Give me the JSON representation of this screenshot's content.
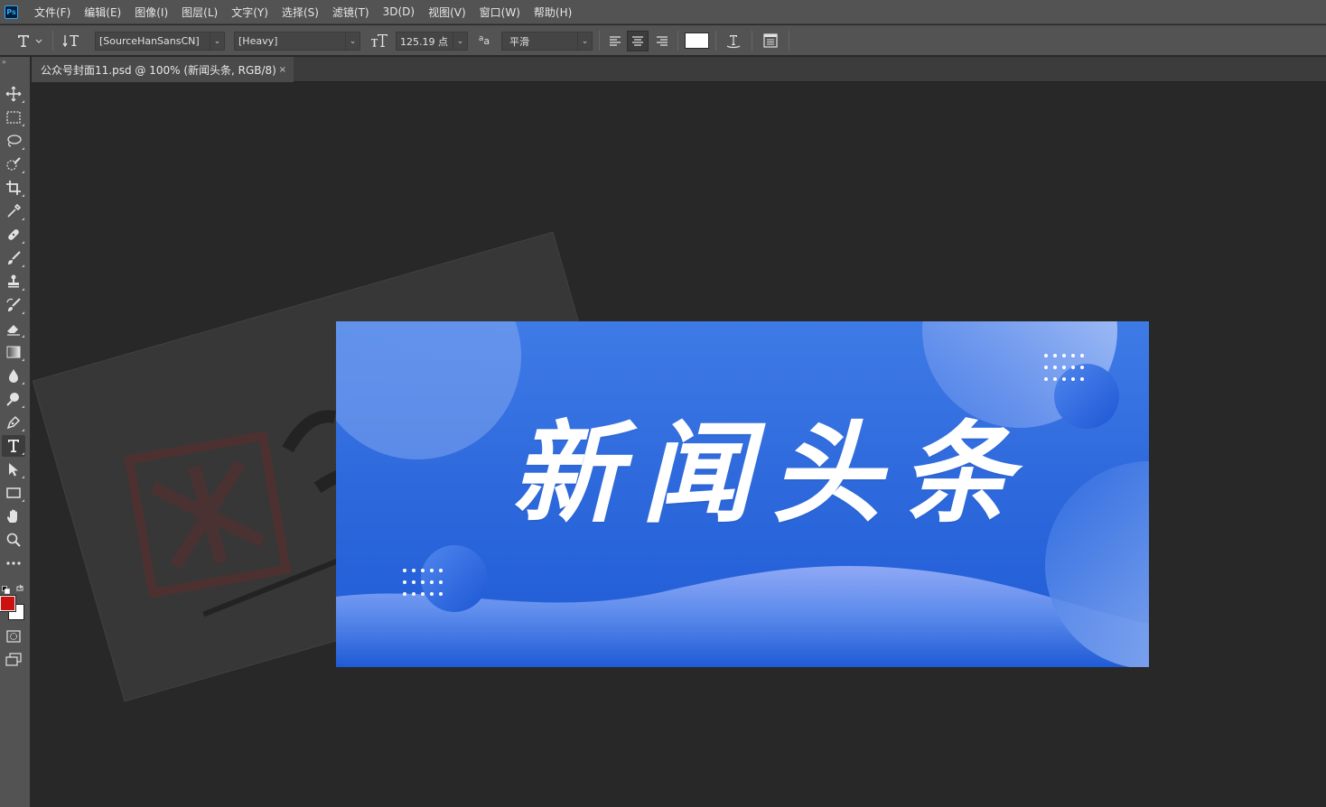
{
  "app": {
    "logo": "Ps"
  },
  "menu": [
    "文件(F)",
    "编辑(E)",
    "图像(I)",
    "图层(L)",
    "文字(Y)",
    "选择(S)",
    "滤镜(T)",
    "3D(D)",
    "视图(V)",
    "窗口(W)",
    "帮助(H)"
  ],
  "options": {
    "font_family": "[SourceHanSansCN]",
    "font_style": "[Heavy]",
    "font_size": "125.19 点",
    "antialias": "平滑",
    "antialias_icon_label": "a",
    "text_color": "#ffffff"
  },
  "tab": {
    "title": "公众号封面11.psd @ 100% (新闻头条, RGB/8)",
    "close": "×"
  },
  "canvas": {
    "headline": "新闻头条",
    "colors": {
      "bg_top": "#3f7be6",
      "bg_bottom": "#1f5bd6",
      "wave_light": "#8fa8f5"
    }
  },
  "colors": {
    "foreground": "#cc1111",
    "background": "#ffffff",
    "accent": "#31a8ff"
  }
}
